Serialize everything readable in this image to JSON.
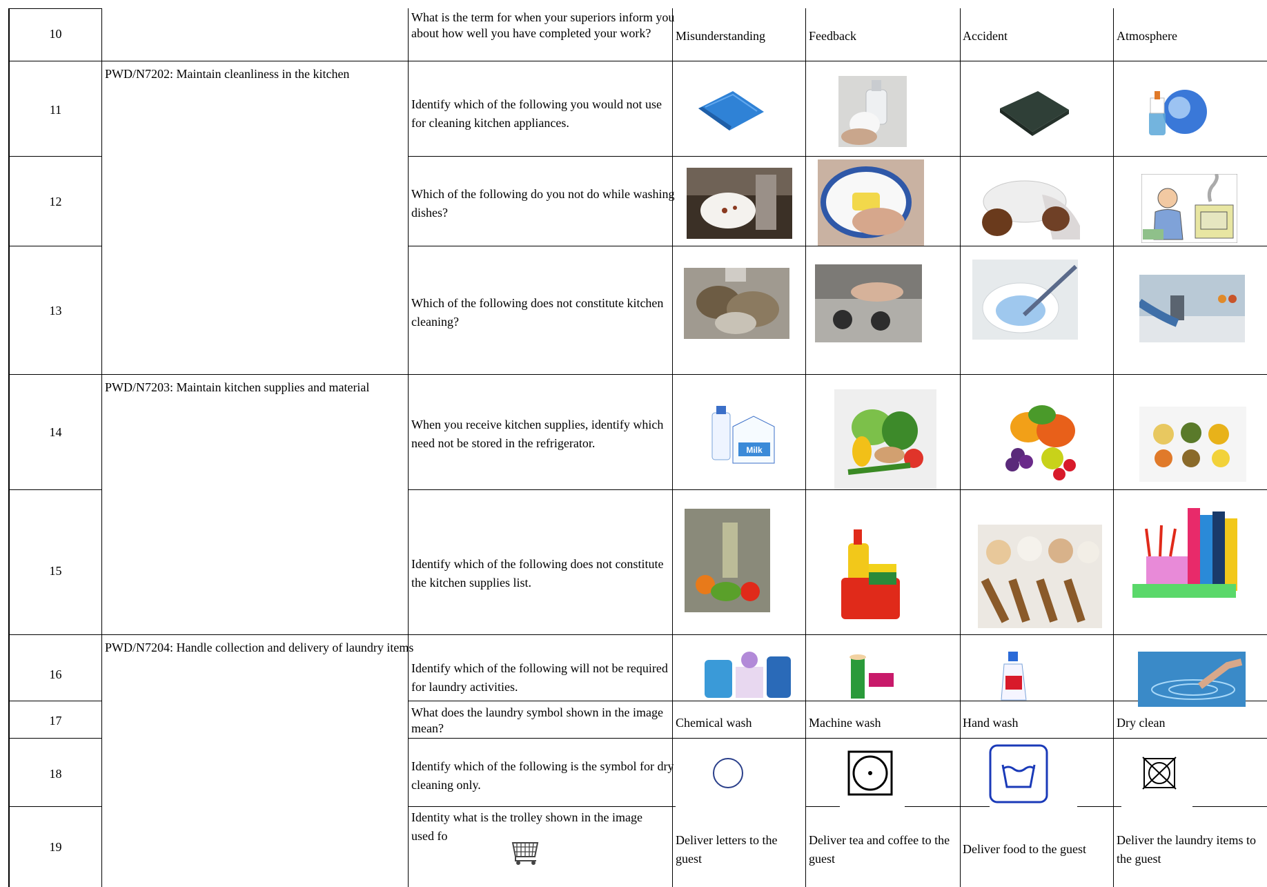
{
  "rows": [
    {
      "num": "10",
      "unit": "",
      "question": "What is the term for when your superiors inform you about how well you have completed your work?",
      "options": [
        "Misunderstanding",
        "Feedback",
        "Accident",
        "Atmosphere"
      ]
    },
    {
      "num": "11",
      "unit": "PWD/N7202:  Maintain cleanliness  in the  kitchen",
      "question": "Identify which of the following you would not use for cleaning kitchen appliances.",
      "option_icons": [
        "blue-microfiber-cloth-icon",
        "soap-foam-hands-icon",
        "green-scrub-pad-icon",
        "mosquito-repellent-icon"
      ]
    },
    {
      "num": "12",
      "unit": "",
      "question": "Which of the following do you not do while washing dishes?",
      "option_icons": [
        "scraping-plate-icon",
        "sponge-washing-plate-icon",
        "stacking-plates-icon",
        "person-smoke-stove-icon"
      ]
    },
    {
      "num": "13",
      "unit": "",
      "question": "Which of the following does not constitute kitchen cleaning?",
      "option_icons": [
        "dirty-dishes-sink-icon",
        "cleaning-stove-icon",
        "cleaning-toilet-icon",
        "spraying-counter-icon"
      ]
    },
    {
      "num": "14",
      "unit": "PWD/N7203: Maintain kitchen supplies and material",
      "question": "When you receive kitchen supplies, identify which need not be stored in the refrigerator.",
      "option_icons": [
        "milk-cartons-icon",
        "vegetables-icon",
        "fruits-icon",
        "pulses-bowls-icon"
      ]
    },
    {
      "num": "15",
      "unit": "",
      "question": "Identify which of the following does not constitute the kitchen supplies list.",
      "option_icons": [
        "vegetables-oil-icon",
        "dish-soap-sponge-icon",
        "grains-flour-icon",
        "stationery-icon"
      ]
    },
    {
      "num": "16",
      "unit": "PWD/N7204: Handle collection and delivery of laundry items",
      "question": "Identify which of the following will not be required for laundry activities.",
      "option_icons": [
        "detergent-bottles-icon",
        "thread-spools-icon",
        "bleach-bottle-icon",
        "water-hand-icon"
      ]
    },
    {
      "num": "17",
      "unit": "",
      "question": "What does the laundry symbol shown in the image mean?",
      "options": [
        "Chemical wash",
        "Machine wash",
        "Hand wash",
        "Dry clean"
      ]
    },
    {
      "num": "18",
      "unit": "",
      "question": "Identify which of the following is the symbol for dry cleaning only.",
      "option_icons": [
        "circle-symbol-icon",
        "tumble-dry-symbol-icon",
        "wash-tub-symbol-icon",
        "do-not-tumble-dry-symbol-icon"
      ]
    },
    {
      "num": "19",
      "unit": "",
      "question": "Identity what is the trolley shown in the image used fo",
      "question_icon": "trolley-icon",
      "options": [
        "Deliver letters to the guest",
        "Deliver tea and coffee to the guest",
        "Deliver food to the guest",
        "Deliver the laundry items to the guest"
      ]
    }
  ],
  "photo_captions": {
    "milk": "Milk"
  }
}
